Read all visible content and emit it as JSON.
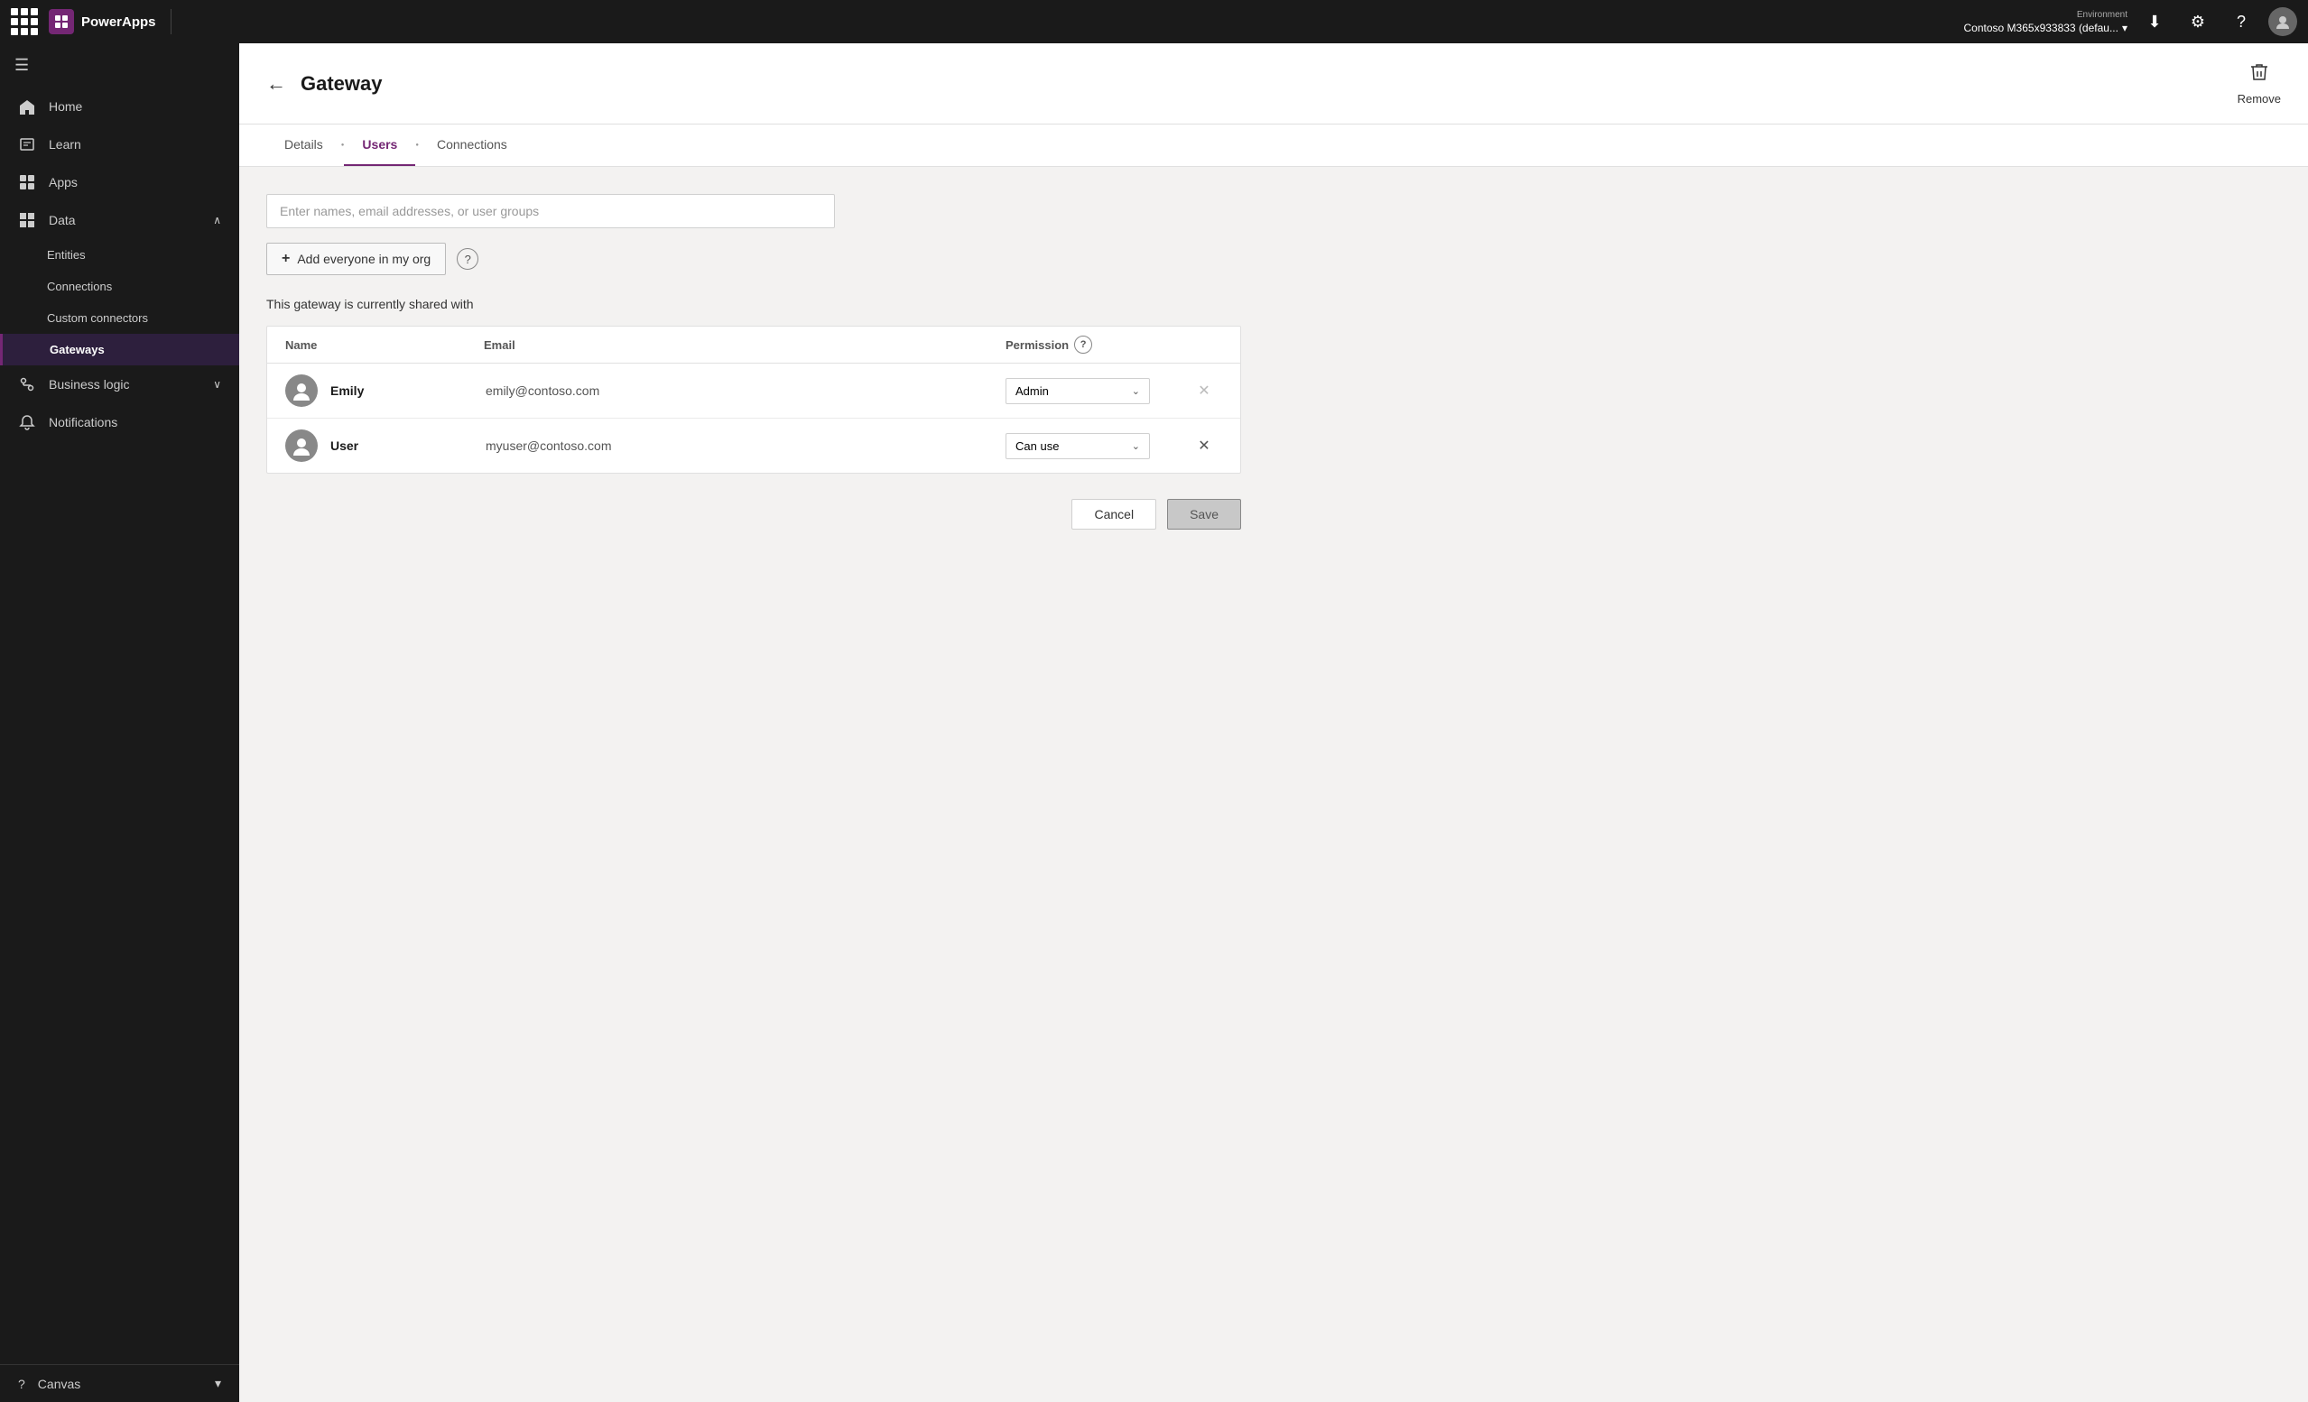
{
  "topbar": {
    "app_name": "PowerApps",
    "environment_label": "Environment",
    "environment_name": "Contoso M365x933833 (defau...",
    "download_icon": "⬇",
    "settings_icon": "⚙",
    "help_icon": "?",
    "chevron_icon": "⌄"
  },
  "sidebar": {
    "hamburger_icon": "☰",
    "items": [
      {
        "id": "home",
        "label": "Home",
        "icon": "⌂",
        "has_chevron": false
      },
      {
        "id": "learn",
        "label": "Learn",
        "icon": "📖",
        "has_chevron": false
      },
      {
        "id": "apps",
        "label": "Apps",
        "icon": "⊞",
        "has_chevron": false
      },
      {
        "id": "data",
        "label": "Data",
        "icon": "▦",
        "has_chevron": true,
        "expanded": true
      }
    ],
    "sub_items": [
      {
        "id": "entities",
        "label": "Entities"
      },
      {
        "id": "connections",
        "label": "Connections"
      },
      {
        "id": "custom-connectors",
        "label": "Custom connectors"
      },
      {
        "id": "gateways",
        "label": "Gateways",
        "active": true
      }
    ],
    "items_below": [
      {
        "id": "business-logic",
        "label": "Business logic",
        "icon": "⚡",
        "has_chevron": true
      },
      {
        "id": "notifications",
        "label": "Notifications",
        "icon": "🔔",
        "has_chevron": false
      }
    ],
    "bottom": [
      {
        "id": "canvas",
        "label": "Canvas",
        "icon": "?",
        "has_chevron": true
      }
    ]
  },
  "page": {
    "title": "Gateway",
    "back_icon": "←",
    "remove_label": "Remove",
    "remove_icon": "🗑"
  },
  "tabs": [
    {
      "id": "details",
      "label": "Details",
      "active": false
    },
    {
      "id": "users",
      "label": "Users",
      "active": true
    },
    {
      "id": "connections",
      "label": "Connections",
      "active": false
    }
  ],
  "users_panel": {
    "search_placeholder": "Enter names, email addresses, or user groups",
    "add_everyone_label": "Add everyone in my org",
    "help_icon": "?",
    "shared_label": "This gateway is currently shared with",
    "table_headers": {
      "name": "Name",
      "email": "Email",
      "permission": "Permission",
      "permission_help": "?"
    },
    "users": [
      {
        "id": "emily",
        "name": "Emily",
        "email": "emily@contoso.com",
        "permission": "Admin",
        "can_remove": false
      },
      {
        "id": "user",
        "name": "User",
        "email": "myuser@contoso.com",
        "permission": "Can use",
        "can_remove": true
      }
    ],
    "cancel_label": "Cancel",
    "save_label": "Save"
  }
}
